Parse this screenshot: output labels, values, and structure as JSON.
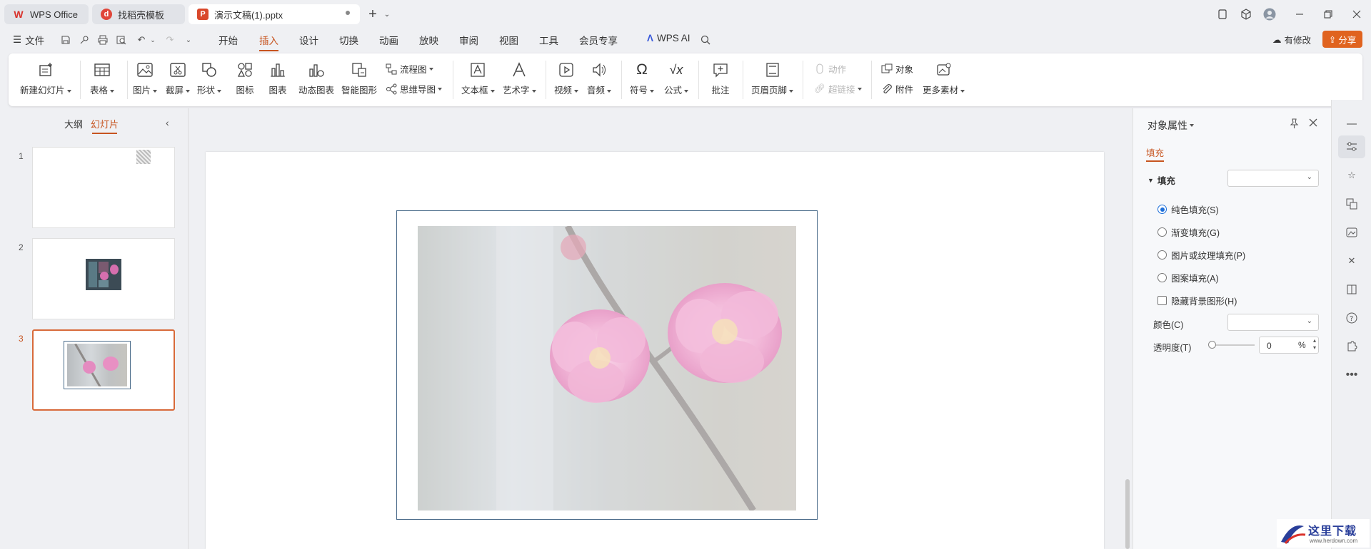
{
  "tabs": [
    {
      "label": "WPS Office",
      "icon": "wps-logo-icon"
    },
    {
      "label": "找稻壳模板",
      "icon": "docer-icon"
    },
    {
      "label": "演示文稿(1).pptx",
      "icon": "presentation-icon"
    }
  ],
  "menu": {
    "file_label": "文件",
    "items": [
      "开始",
      "插入",
      "设计",
      "切换",
      "动画",
      "放映",
      "审阅",
      "视图",
      "工具",
      "会员专享"
    ],
    "active": "插入",
    "ai_label": "WPS AI",
    "modify_label": "有修改",
    "share_label": "分享"
  },
  "ribbon": {
    "new_slide": "新建幻灯片",
    "table": "表格",
    "picture": "图片",
    "screenshot": "截屏",
    "shape": "形状",
    "icon": "图标",
    "chart": "图表",
    "dynamic_chart": "动态图表",
    "smart_graphic": "智能图形",
    "flowchart": "流程图",
    "mindmap": "思维导图",
    "textbox": "文本框",
    "wordart": "艺术字",
    "video": "视频",
    "audio": "音频",
    "symbol": "符号",
    "formula": "公式",
    "comment": "批注",
    "header_footer": "页眉页脚",
    "action": "动作",
    "hyperlink": "超链接",
    "object": "对象",
    "attachment": "附件",
    "more_materials": "更多素材"
  },
  "left_panel": {
    "tab_outline": "大纲",
    "tab_slides": "幻灯片",
    "slides": [
      {
        "num": "1"
      },
      {
        "num": "2"
      },
      {
        "num": "3"
      }
    ],
    "selected": "3"
  },
  "right_panel": {
    "title": "对象属性",
    "tab_fill": "填充",
    "section_fill": "填充",
    "options": [
      "纯色填充(S)",
      "渐变填充(G)",
      "图片或纹理填充(P)",
      "图案填充(A)"
    ],
    "selected_option": "纯色填充(S)",
    "hide_bg_label": "隐藏背景图形(H)",
    "color_label": "颜色(C)",
    "transparency_label": "透明度(T)",
    "transparency_value": "0",
    "percent": "%"
  },
  "watermark": {
    "text": "这里下载",
    "url_text": "www.herdown.com"
  },
  "colors": {
    "accent": "#c7541f",
    "share_bg": "#e0631f",
    "radio_blue": "#1e6fd9"
  }
}
